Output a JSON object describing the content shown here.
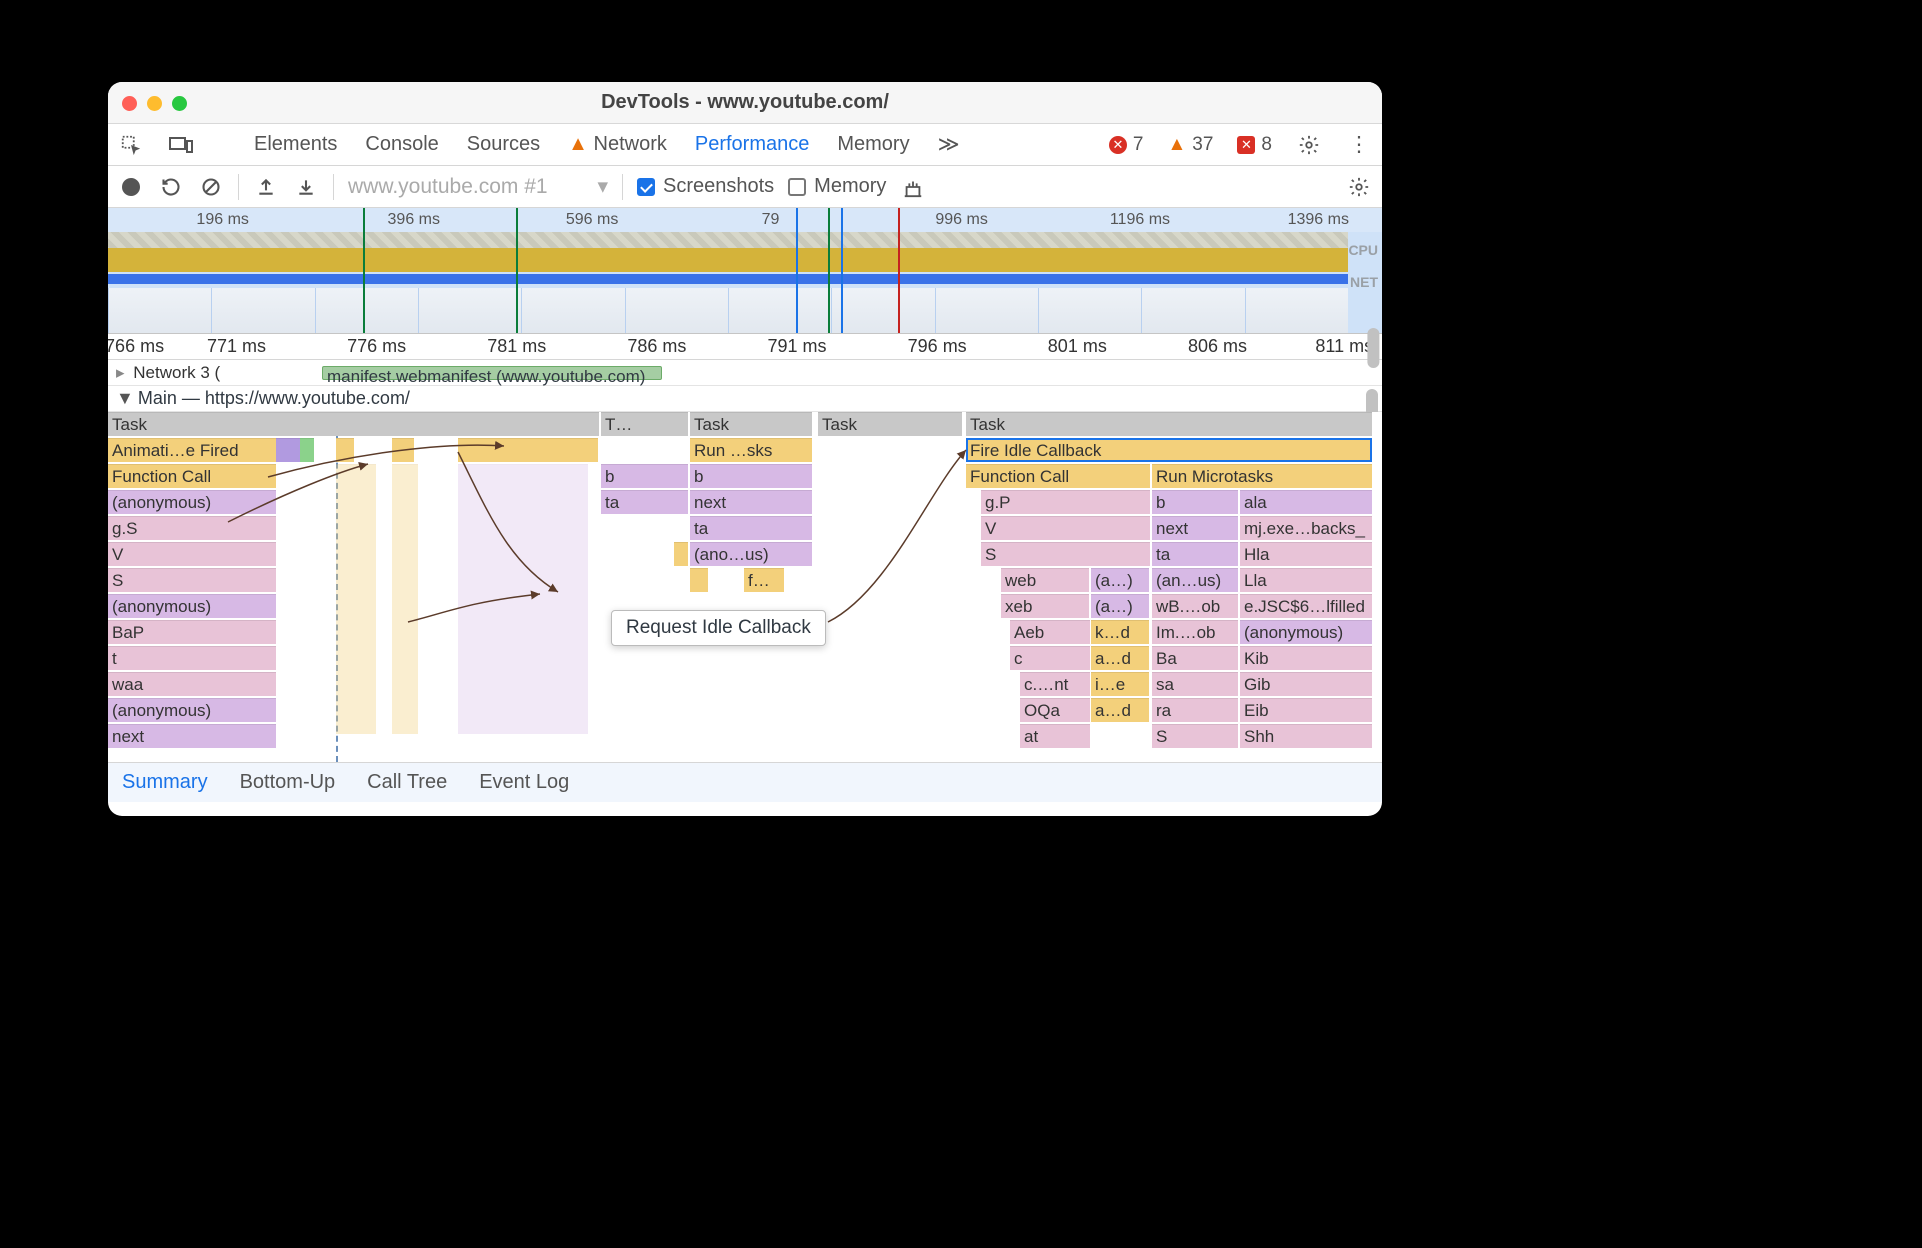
{
  "titlebar": {
    "title": "DevTools - www.youtube.com/"
  },
  "tabs": {
    "elements": "Elements",
    "console": "Console",
    "sources": "Sources",
    "network": "Network",
    "performance": "Performance",
    "memory": "Memory"
  },
  "issues": {
    "errors": "7",
    "warnings": "37",
    "violations": "8"
  },
  "toolbar": {
    "recording_label": "www.youtube.com #1",
    "screenshots": "Screenshots",
    "memory": "Memory"
  },
  "overview": {
    "ticks": [
      "196 ms",
      "396 ms",
      "596 ms",
      "79",
      "996 ms",
      "1196 ms",
      "1396 ms"
    ],
    "labels": {
      "cpu": "CPU",
      "net": "NET"
    }
  },
  "ruler": [
    "766 ms",
    "771 ms",
    "776 ms",
    "781 ms",
    "786 ms",
    "791 ms",
    "796 ms",
    "801 ms",
    "806 ms",
    "811 ms"
  ],
  "network_section": {
    "header": "Network  3 (",
    "request": "manifest.webmanifest (www.youtube.com)"
  },
  "main_section": {
    "header": "Main — https://www.youtube.com/"
  },
  "tooltip": {
    "text": "Request Idle Callback"
  },
  "flame": {
    "tasks": [
      "Task",
      "T…",
      "Task",
      "Task",
      "Task"
    ],
    "col0": [
      "Animati…e Fired",
      "Function Call",
      "(anonymous)",
      "g.S",
      "V",
      "S",
      "(anonymous)",
      "BaP",
      "t",
      "waa",
      "(anonymous)",
      "next"
    ],
    "colMidA": [
      "b",
      "ta"
    ],
    "colMidB": [
      "Run …sks",
      "b",
      "next",
      "ta",
      "(ano…us)",
      "f…"
    ],
    "col4_main": "Fire Idle Callback",
    "col4_l1": [
      "Function Call",
      "Run Microtasks"
    ],
    "col4_l2a": "g.P",
    "col4_l2b": [
      "b",
      "ala"
    ],
    "col4_l3a": "V",
    "col4_l3b": [
      "next",
      "mj.exe…backs_"
    ],
    "col4_l4a": "S",
    "col4_l4b": [
      "ta",
      "Hla"
    ],
    "col4_l5": [
      "web",
      "(a…)",
      "(an…us)",
      "Lla"
    ],
    "col4_l6": [
      "xeb",
      "(a…)",
      "wB.…ob",
      "e.JSC$6…lfilled"
    ],
    "col4_l7": [
      "Aeb",
      "k…d",
      "Im.…ob",
      "(anonymous)"
    ],
    "col4_l8": [
      "c",
      "a…d",
      "Ba",
      "Kib"
    ],
    "col4_l9": [
      "c.…nt",
      "i…e",
      "sa",
      "Gib"
    ],
    "col4_l10": [
      "OQa",
      "a…d",
      "ra",
      "Eib"
    ],
    "col4_l11": [
      "at",
      "",
      "S",
      "Shh"
    ]
  },
  "bottom_tabs": {
    "summary": "Summary",
    "bottomup": "Bottom-Up",
    "calltree": "Call Tree",
    "eventlog": "Event Log"
  }
}
